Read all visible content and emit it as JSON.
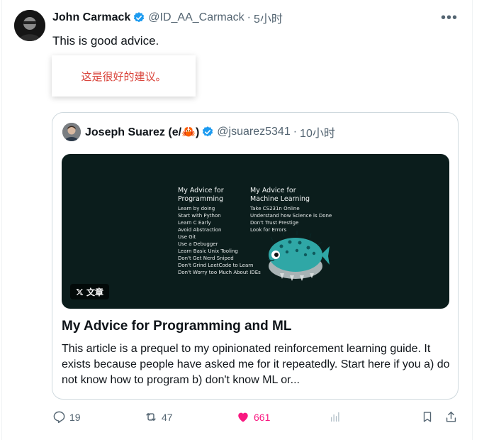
{
  "tweet": {
    "author_name": "John Carmack",
    "handle": "@ID_AA_Carmack",
    "separator": "·",
    "time": "5小时",
    "more_icon": "more-horizontal-icon",
    "text": "This is good advice.",
    "translation": "这是很好的建议。"
  },
  "quote": {
    "author_name": "Joseph Suarez (e/🦀)",
    "handle": "@jsuarez5341",
    "separator": "·",
    "time": "10小时",
    "image": {
      "col1_title_1": "My Advice for",
      "col1_title_2": "Programming",
      "col1_items": [
        "Learn by doing",
        "Start with Python",
        "Learn C Early",
        "Avoid Abstraction",
        "Use Git",
        "Use a Debugger",
        "Learn Basic Unix Tooling",
        "Don't Get Nerd Sniped",
        "Don't Grind LeetCode to Learn",
        "Don't Worry too Much About IDEs"
      ],
      "col2_title_1": "My Advice for",
      "col2_title_2": "Machine Learning",
      "col2_items": [
        "Take CS231n Online",
        "Understand how Science is Done",
        "Don't Trust Prestige",
        "Look for Errors"
      ],
      "tag_label": "文章"
    },
    "article_title": "My Advice for Programming and ML",
    "article_body": "This article is a prequel to my opinionated reinforcement learning guide. It exists because people have asked me for it repeatedly. Start here if you a) do not know how to program b) don't know ML or..."
  },
  "actions": {
    "replies": "19",
    "reposts": "47",
    "likes": "661"
  },
  "colors": {
    "verified": "#1d9bf0",
    "like": "#f91880",
    "muted": "#536471",
    "translation": "#d9433a"
  }
}
